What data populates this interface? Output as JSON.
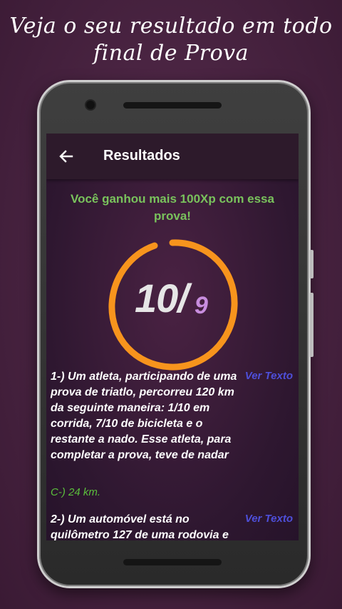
{
  "promo": {
    "line1": "Veja o seu resultado em todo",
    "line2": "final de Prova"
  },
  "appbar": {
    "back_icon": "arrow-left-icon",
    "title": "Resultados"
  },
  "result": {
    "xp_message": "Você ganhou mais 100Xp com essa prova!",
    "score": "10/",
    "total": "9",
    "ring_color": "#f7941d"
  },
  "questions": [
    {
      "text": "1-) Um atleta, participando de uma prova de triatlo, percorreu 120 km da seguinte maneira: 1/10 em corrida, 7/10 de bicicleta e o restante a nado. Esse atleta, para completar a prova, teve de nadar",
      "link": "Ver Texto",
      "answer": "C-) 24 km."
    },
    {
      "text": "2-) Um automóvel está no quilômetro 127 de uma rodovia e",
      "link": "Ver Texto"
    }
  ],
  "colors": {
    "background": "#4a2442",
    "appbar": "#2d1a2b",
    "xp_text": "#79c25c",
    "link": "#4e4fd9",
    "answer": "#5bbf3c"
  }
}
